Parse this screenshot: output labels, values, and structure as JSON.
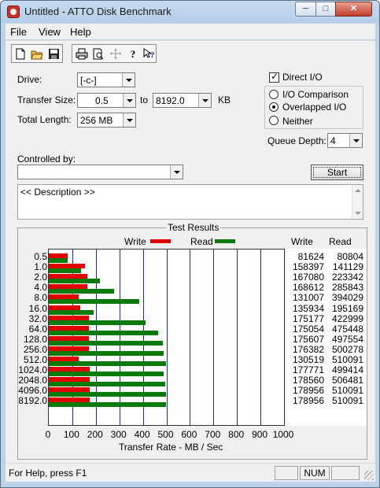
{
  "window": {
    "title": "Untitled - ATTO Disk Benchmark",
    "min_glyph": "─",
    "max_glyph": "□",
    "close_glyph": "✕"
  },
  "menu": {
    "file": "File",
    "view": "View",
    "help": "Help"
  },
  "toolbar": {
    "icons": [
      "new-file-icon",
      "open-folder-icon",
      "save-icon",
      "print-icon",
      "print-preview-icon",
      "move-icon",
      "help-icon",
      "context-help-icon"
    ]
  },
  "form": {
    "drive_label": "Drive:",
    "drive_value": "[-c-]",
    "transfer_size_label": "Transfer Size:",
    "transfer_from": "0.5",
    "transfer_to_label": "to",
    "transfer_to": "8192.0",
    "transfer_unit": "KB",
    "total_length_label": "Total Length:",
    "total_length": "256 MB",
    "controlled_by_label": "Controlled by:",
    "controlled_by_value": "",
    "description": "<< Description >>",
    "start_label": "Start"
  },
  "options": {
    "direct_io_label": "Direct I/O",
    "direct_io_checked": true,
    "io_comparison_label": "I/O Comparison",
    "overlapped_io_label": "Overlapped I/O",
    "neither_label": "Neither",
    "selected": "overlapped",
    "queue_depth_label": "Queue Depth:",
    "queue_depth": "4"
  },
  "results": {
    "title": "Test Results",
    "write_legend": "Write",
    "read_legend": "Read",
    "write_color": "#e00000",
    "read_color": "#0a7a0a",
    "write_col_head": "Write",
    "read_col_head": "Read",
    "xaxis_label": "Transfer Rate - MB / Sec"
  },
  "chart_data": {
    "type": "bar",
    "title": "Test Results",
    "xlabel": "Transfer Rate - MB / Sec",
    "ylabel": "",
    "xlim": [
      0,
      1000
    ],
    "xticks": [
      "0",
      "100",
      "200",
      "300",
      "400",
      "500",
      "600",
      "700",
      "800",
      "900",
      "1000"
    ],
    "categories": [
      "0.5",
      "1.0",
      "2.0",
      "4.0",
      "8.0",
      "16.0",
      "32.0",
      "64.0",
      "128.0",
      "256.0",
      "512.0",
      "1024.0",
      "2048.0",
      "4096.0",
      "8192.0"
    ],
    "series": [
      {
        "name": "Write",
        "values": [
          80,
          155,
          163,
          165,
          128,
          133,
          171,
          171,
          172,
          172,
          127,
          174,
          174,
          175,
          175
        ],
        "labels": [
          "81624",
          "158397",
          "167080",
          "168612",
          "131007",
          "135934",
          "175177",
          "175054",
          "175607",
          "176382",
          "130519",
          "177771",
          "178560",
          "178956",
          "178956"
        ]
      },
      {
        "name": "Read",
        "values": [
          79,
          138,
          218,
          279,
          385,
          191,
          413,
          464,
          486,
          488,
          498,
          488,
          495,
          498,
          498
        ],
        "labels": [
          "80804",
          "141129",
          "223342",
          "285843",
          "394029",
          "195169",
          "422999",
          "475448",
          "497554",
          "500278",
          "510091",
          "499414",
          "506481",
          "510091",
          "510091"
        ]
      }
    ],
    "grid": true,
    "legend": "top"
  },
  "status": {
    "help_text": "For Help, press F1",
    "num": "NUM"
  }
}
